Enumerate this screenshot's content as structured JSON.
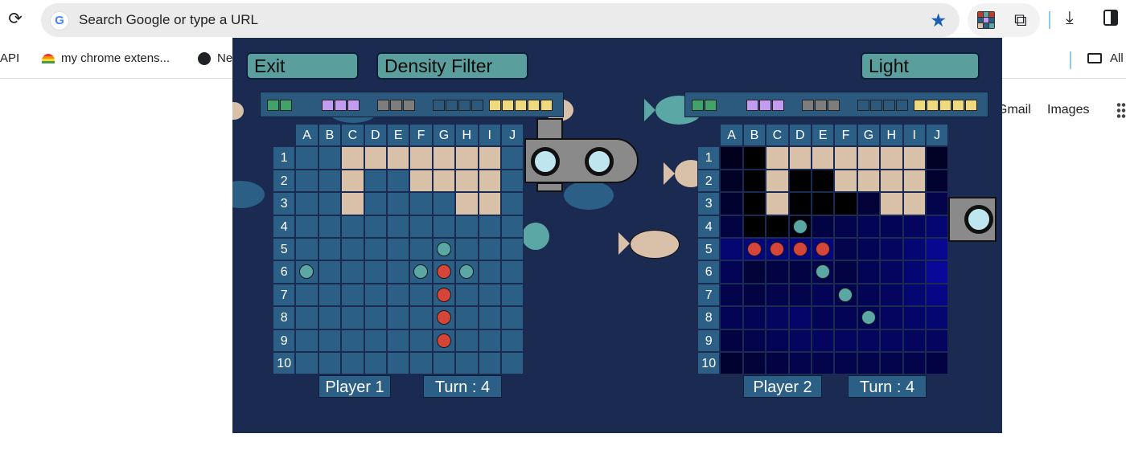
{
  "browser": {
    "omnibox_placeholder": "Search Google or type a URL",
    "google_logo_letter": "G",
    "bookmarks": [
      "API",
      "my chrome extens...",
      "Ne",
      "All"
    ],
    "page_links": [
      "Gmail",
      "Images"
    ]
  },
  "game": {
    "buttons": {
      "exit": "Exit",
      "density": "Density Filter",
      "light": "Light"
    },
    "columns": [
      "A",
      "B",
      "C",
      "D",
      "E",
      "F",
      "G",
      "H",
      "I",
      "J"
    ],
    "rows": [
      "1",
      "2",
      "3",
      "4",
      "5",
      "6",
      "7",
      "8",
      "9",
      "10"
    ],
    "fleet_colors": {
      "ship2": "#3fa36a",
      "ship3a": "#c39bf0",
      "ship3b": "#7d7d7d",
      "ship4": "#2c5a7e",
      "ship5": "#f0d97a"
    },
    "player1": {
      "name": "Player 1",
      "turn": "Turn : 4",
      "revealed": [
        [
          0,
          2
        ],
        [
          0,
          3
        ],
        [
          0,
          4
        ],
        [
          0,
          5
        ],
        [
          0,
          6
        ],
        [
          0,
          7
        ],
        [
          0,
          8
        ],
        [
          1,
          2
        ],
        [
          1,
          5
        ],
        [
          1,
          6
        ],
        [
          1,
          7
        ],
        [
          1,
          8
        ],
        [
          2,
          2
        ],
        [
          2,
          7
        ],
        [
          2,
          8
        ]
      ],
      "hits": [
        [
          5,
          6
        ],
        [
          6,
          6
        ],
        [
          7,
          6
        ],
        [
          8,
          6
        ]
      ],
      "misses": [
        [
          4,
          6
        ],
        [
          5,
          0
        ],
        [
          5,
          5
        ],
        [
          5,
          7
        ]
      ]
    },
    "player2": {
      "name": "Player 2",
      "turn": "Turn : 4",
      "revealed": [
        [
          0,
          2
        ],
        [
          0,
          3
        ],
        [
          0,
          4
        ],
        [
          0,
          5
        ],
        [
          0,
          6
        ],
        [
          0,
          7
        ],
        [
          0,
          8
        ],
        [
          1,
          2
        ],
        [
          1,
          5
        ],
        [
          1,
          6
        ],
        [
          1,
          7
        ],
        [
          1,
          8
        ],
        [
          2,
          2
        ],
        [
          2,
          7
        ],
        [
          2,
          8
        ]
      ],
      "black": [
        [
          0,
          1
        ],
        [
          1,
          1
        ],
        [
          1,
          3
        ],
        [
          1,
          4
        ],
        [
          2,
          1
        ],
        [
          2,
          3
        ],
        [
          2,
          4
        ],
        [
          2,
          5
        ],
        [
          3,
          1
        ],
        [
          3,
          2
        ]
      ],
      "hits": [
        [
          4,
          1
        ],
        [
          4,
          2
        ],
        [
          4,
          3
        ],
        [
          4,
          4
        ]
      ],
      "misses": [
        [
          3,
          3
        ],
        [
          5,
          4
        ],
        [
          6,
          5
        ],
        [
          7,
          6
        ]
      ],
      "density": [
        [
          0.1,
          0,
          0,
          0,
          0,
          0,
          0,
          0,
          0,
          0.15
        ],
        [
          0.15,
          0,
          0,
          0,
          0,
          0,
          0,
          0,
          0,
          0.2
        ],
        [
          0.2,
          0,
          0,
          0,
          0,
          0,
          0.25,
          0,
          0,
          0.35
        ],
        [
          0.3,
          0,
          0,
          0,
          0.3,
          0.35,
          0.4,
          0.4,
          0.45,
          0.55
        ],
        [
          0.55,
          0.6,
          0.6,
          0.6,
          0.6,
          0.35,
          0.4,
          0.45,
          0.55,
          0.7
        ],
        [
          0.4,
          0.25,
          0.3,
          0.3,
          0.35,
          0.3,
          0.4,
          0.45,
          0.55,
          0.75
        ],
        [
          0.35,
          0.3,
          0.35,
          0.35,
          0.4,
          0.35,
          0.4,
          0.45,
          0.55,
          0.65
        ],
        [
          0.4,
          0.4,
          0.45,
          0.5,
          0.4,
          0.4,
          0.4,
          0.45,
          0.5,
          0.55
        ],
        [
          0.3,
          0.35,
          0.4,
          0.45,
          0.45,
          0.45,
          0.45,
          0.45,
          0.45,
          0.45
        ],
        [
          0.2,
          0.25,
          0.3,
          0.35,
          0.35,
          0.35,
          0.35,
          0.35,
          0.35,
          0.3
        ]
      ]
    }
  }
}
